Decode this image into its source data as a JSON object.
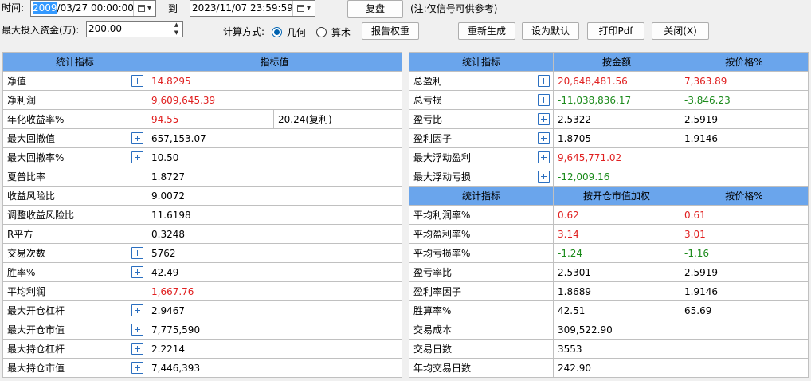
{
  "toolbar": {
    "time_label": "时间:",
    "start_selected": "2009",
    "start_rest": "/03/27 00:00:00",
    "to_label": "到",
    "end_value": "2023/11/07 23:59:59",
    "replay_button": "复盘",
    "note": "(注:仅信号可供参考)",
    "capital_label": "最大投入资金(万):",
    "capital_value": "200.00",
    "calc_label": "计算方式:",
    "radio_geometric": "几何",
    "radio_arithmetic": "算术",
    "report_weight_button": "报告权重",
    "regenerate_button": "重新生成",
    "set_default_button": "设为默认",
    "print_pdf_button": "打印Pdf",
    "close_button": "关闭(X)",
    "selected_method": "几何"
  },
  "left_table": {
    "headers": [
      "统计指标",
      "指标值"
    ],
    "rows": [
      {
        "name": "净值",
        "value": "14.8295",
        "color": "red",
        "expand": true
      },
      {
        "name": "净利润",
        "value": "9,609,645.39",
        "color": "red",
        "expand": false
      },
      {
        "name": "年化收益率%",
        "value": "94.55",
        "value2": "20.24(复利)",
        "color": "red",
        "expand": false
      },
      {
        "name": "最大回撤值",
        "value": "657,153.07",
        "expand": true
      },
      {
        "name": "最大回撤率%",
        "value": "10.50",
        "expand": true
      },
      {
        "name": "夏普比率",
        "value": "1.8727",
        "expand": false
      },
      {
        "name": "收益风险比",
        "value": "9.0072",
        "expand": false
      },
      {
        "name": "调整收益风险比",
        "value": "11.6198",
        "expand": false
      },
      {
        "name": "R平方",
        "value": "0.3248",
        "expand": false
      },
      {
        "name": "交易次数",
        "value": "5762",
        "expand": true
      },
      {
        "name": "胜率%",
        "value": "42.49",
        "expand": true
      },
      {
        "name": "平均利润",
        "value": "1,667.76",
        "color": "red",
        "expand": false
      },
      {
        "name": "最大开仓杠杆",
        "value": "2.9467",
        "expand": true
      },
      {
        "name": "最大开仓市值",
        "value": "7,775,590",
        "expand": true
      },
      {
        "name": "最大持仓杠杆",
        "value": "2.2214",
        "expand": true
      },
      {
        "name": "最大持仓市值",
        "value": "7,446,393",
        "expand": true
      }
    ]
  },
  "right_table_top": {
    "headers": [
      "统计指标",
      "按金额",
      "按价格%"
    ],
    "rows": [
      {
        "name": "总盈利",
        "v1": "20,648,481.56",
        "v2": "7,363.89",
        "color": "red",
        "expand": true
      },
      {
        "name": "总亏损",
        "v1": "-11,038,836.17",
        "v2": "-3,846.23",
        "color": "green",
        "expand": true
      },
      {
        "name": "盈亏比",
        "v1": "2.5322",
        "v2": "2.5919",
        "expand": true
      },
      {
        "name": "盈利因子",
        "v1": "1.8705",
        "v2": "1.9146",
        "expand": true
      },
      {
        "name": "最大浮动盈利",
        "v1": "9,645,771.02",
        "v2": "",
        "color": "red",
        "expand": true
      },
      {
        "name": "最大浮动亏损",
        "v1": "-12,009.16",
        "v2": "",
        "color": "green",
        "expand": true
      }
    ]
  },
  "right_table_bottom": {
    "headers": [
      "统计指标",
      "按开仓市值加权",
      "按价格%"
    ],
    "rows": [
      {
        "name": "平均利润率%",
        "v1": "0.62",
        "v2": "0.61",
        "color": "red"
      },
      {
        "name": "平均盈利率%",
        "v1": "3.14",
        "v2": "3.01",
        "color": "red"
      },
      {
        "name": "平均亏损率%",
        "v1": "-1.24",
        "v2": "-1.16",
        "color": "green"
      },
      {
        "name": "盈亏率比",
        "v1": "2.5301",
        "v2": "2.5919"
      },
      {
        "name": "盈利率因子",
        "v1": "1.8689",
        "v2": "1.9146"
      },
      {
        "name": "胜算率%",
        "v1": "42.51",
        "v2": "65.69"
      },
      {
        "name": "交易成本",
        "v1": "309,522.90",
        "v2": ""
      },
      {
        "name": "交易日数",
        "v1": "3553",
        "v2": ""
      },
      {
        "name": "年均交易日数",
        "v1": "242.90",
        "v2": ""
      }
    ]
  },
  "colors": {
    "header_bg": "#6aa5ec",
    "positive": "#e02020",
    "negative": "#1a8a1a",
    "selection": "#3399ff"
  },
  "icons": {
    "expand": "plus-box-icon",
    "date_picker": "calendar-dropdown-icon",
    "spinner": "spin-arrows-icon"
  }
}
